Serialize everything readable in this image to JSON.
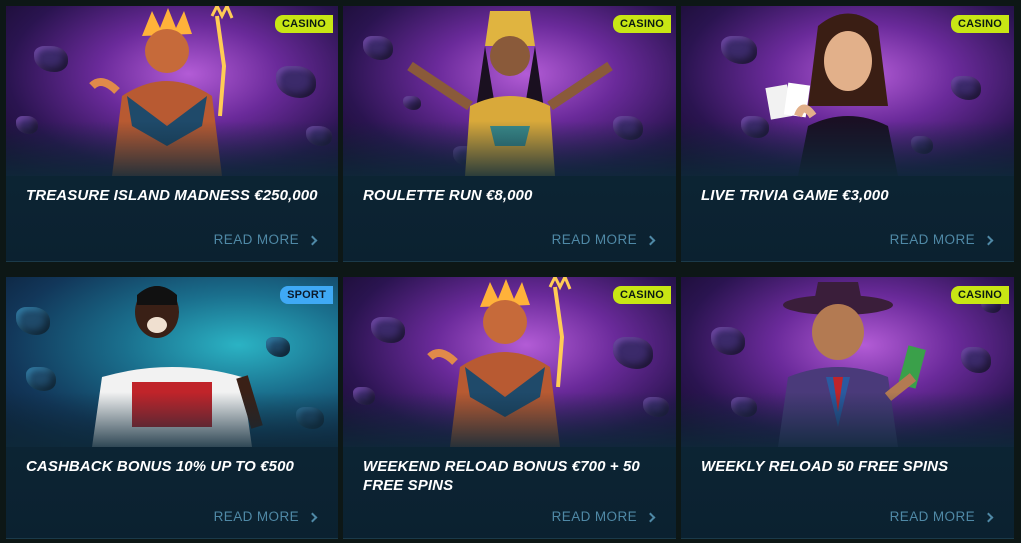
{
  "colors": {
    "casino_badge": "#c8e614",
    "sport_badge": "#3fa9f5",
    "card_bg": "#0e2a3a",
    "read_more": "#4f89a6",
    "page_bg": "#0d1716"
  },
  "cards": [
    {
      "badge": "CASINO",
      "badge_type": "casino",
      "title": "TREASURE ISLAND MADNESS €250,000",
      "read_more": "READ MORE",
      "image_icon": "fire-king-illustration"
    },
    {
      "badge": "CASINO",
      "badge_type": "casino",
      "title": "ROULETTE RUN €8,000",
      "read_more": "READ MORE",
      "image_icon": "egyptian-queen-illustration"
    },
    {
      "badge": "CASINO",
      "badge_type": "casino",
      "title": "LIVE TRIVIA GAME €3,000",
      "read_more": "READ MORE",
      "image_icon": "live-dealer-illustration"
    },
    {
      "badge": "SPORT",
      "badge_type": "sport",
      "title": "CASHBACK BONUS 10% UP TO €500",
      "read_more": "READ MORE",
      "image_icon": "football-player-illustration"
    },
    {
      "badge": "CASINO",
      "badge_type": "casino",
      "title": "WEEKEND RELOAD BONUS €700 + 50 FREE SPINS",
      "read_more": "READ MORE",
      "image_icon": "fire-king-illustration"
    },
    {
      "badge": "CASINO",
      "badge_type": "casino",
      "title": "WEEKLY RELOAD 50 FREE SPINS",
      "read_more": "READ MORE",
      "image_icon": "cowboy-character-illustration"
    }
  ]
}
